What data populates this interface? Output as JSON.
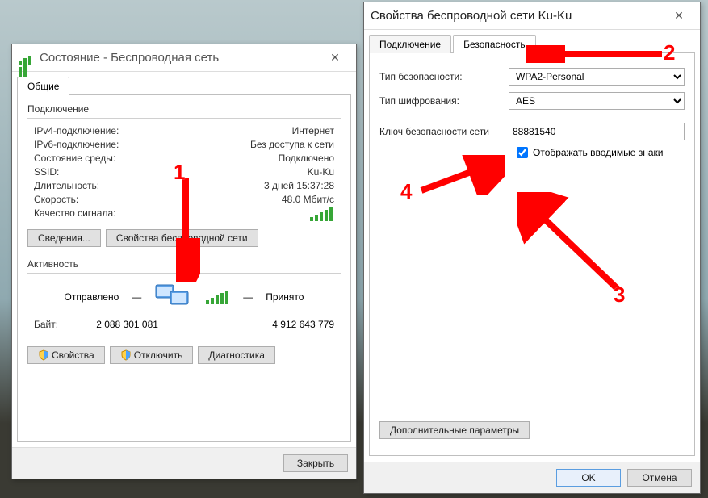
{
  "window1": {
    "title": "Состояние - Беспроводная сеть",
    "tab_general": "Общие",
    "section_connection": "Подключение",
    "ipv4_label": "IPv4-подключение:",
    "ipv4_value": "Интернет",
    "ipv6_label": "IPv6-подключение:",
    "ipv6_value": "Без доступа к сети",
    "media_label": "Состояние среды:",
    "media_value": "Подключено",
    "ssid_label": "SSID:",
    "ssid_value": "Ku-Ku",
    "duration_label": "Длительность:",
    "duration_value": "3 дней 15:37:28",
    "speed_label": "Скорость:",
    "speed_value": "48.0 Мбит/с",
    "quality_label": "Качество сигнала:",
    "btn_details": "Сведения...",
    "btn_wprops": "Свойства беспроводной сети",
    "section_activity": "Активность",
    "sent_label": "Отправлено",
    "recv_label": "Принято",
    "bytes_label": "Байт:",
    "bytes_sent": "2 088 301 081",
    "bytes_recv": "4 912 643 779",
    "btn_props": "Свойства",
    "btn_disable": "Отключить",
    "btn_diag": "Диагностика",
    "btn_close": "Закрыть"
  },
  "window2": {
    "title": "Свойства беспроводной сети Ku-Ku",
    "tab_conn": "Подключение",
    "tab_sec": "Безопасность",
    "sectype_label": "Тип безопасности:",
    "sectype_value": "WPA2-Personal",
    "enc_label": "Тип шифрования:",
    "enc_value": "AES",
    "key_label": "Ключ безопасности сети",
    "key_value": "88881540",
    "showchars_label": "Отображать вводимые знаки",
    "btn_advanced": "Дополнительные параметры",
    "btn_ok": "OK",
    "btn_cancel": "Отмена"
  },
  "annotations": {
    "n1": "1",
    "n2": "2",
    "n3": "3",
    "n4": "4"
  }
}
